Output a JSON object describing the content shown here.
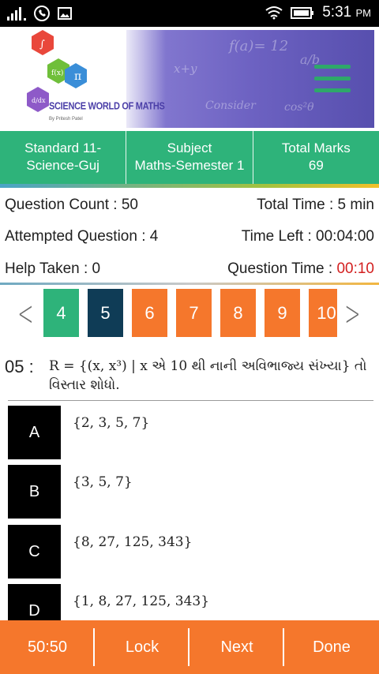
{
  "status_bar": {
    "time": "5:31",
    "ampm": "PM"
  },
  "banner": {
    "logo_title": "SCIENCE WORLD OF MATHS",
    "logo_sub": "By Pritesh Patel",
    "hex_symbols": [
      "∫",
      "π",
      "f(x)",
      "d/dx"
    ]
  },
  "info": [
    {
      "line1": "Standard 11-",
      "line2": "Science-Guj"
    },
    {
      "line1": "Subject",
      "line2": "Maths-Semester 1"
    },
    {
      "line1": "Total Marks",
      "line2": "69"
    }
  ],
  "stats": {
    "question_count": "Question Count : 50",
    "total_time": "Total Time : 5 min",
    "attempted": "Attempted Question : 4",
    "time_left": "Time Left : 00:04:00",
    "help_taken": "Help Taken : 0",
    "question_time_label": "Question Time : ",
    "question_time_value": "00:10"
  },
  "navigator": {
    "prev_glyph": "<",
    "next_glyph": ">",
    "questions": [
      {
        "num": "4",
        "color": "#2eb37a"
      },
      {
        "num": "5",
        "color": "#0f3c56"
      },
      {
        "num": "6",
        "color": "#f5772c"
      },
      {
        "num": "7",
        "color": "#f5772c"
      },
      {
        "num": "8",
        "color": "#f5772c"
      },
      {
        "num": "9",
        "color": "#f5772c"
      },
      {
        "num": "10",
        "color": "#f5772c"
      }
    ]
  },
  "question": {
    "number": "05 :",
    "line1": "R = {(x, x³) | x એ 10 થી નાની અવિભાજ્ય સંખ્યા} તો",
    "line2": "વિસ્તાર શોધો."
  },
  "options": [
    {
      "label": "A",
      "text": "{2, 3, 5, 7}"
    },
    {
      "label": "B",
      "text": "{3, 5, 7}"
    },
    {
      "label": "C",
      "text": "{8, 27, 125, 343}"
    },
    {
      "label": "D",
      "text": "{1, 8, 27, 125, 343}"
    }
  ],
  "bottom_bar": {
    "fifty_fifty": "50:50",
    "lock": "Lock",
    "next": "Next",
    "done": "Done"
  }
}
